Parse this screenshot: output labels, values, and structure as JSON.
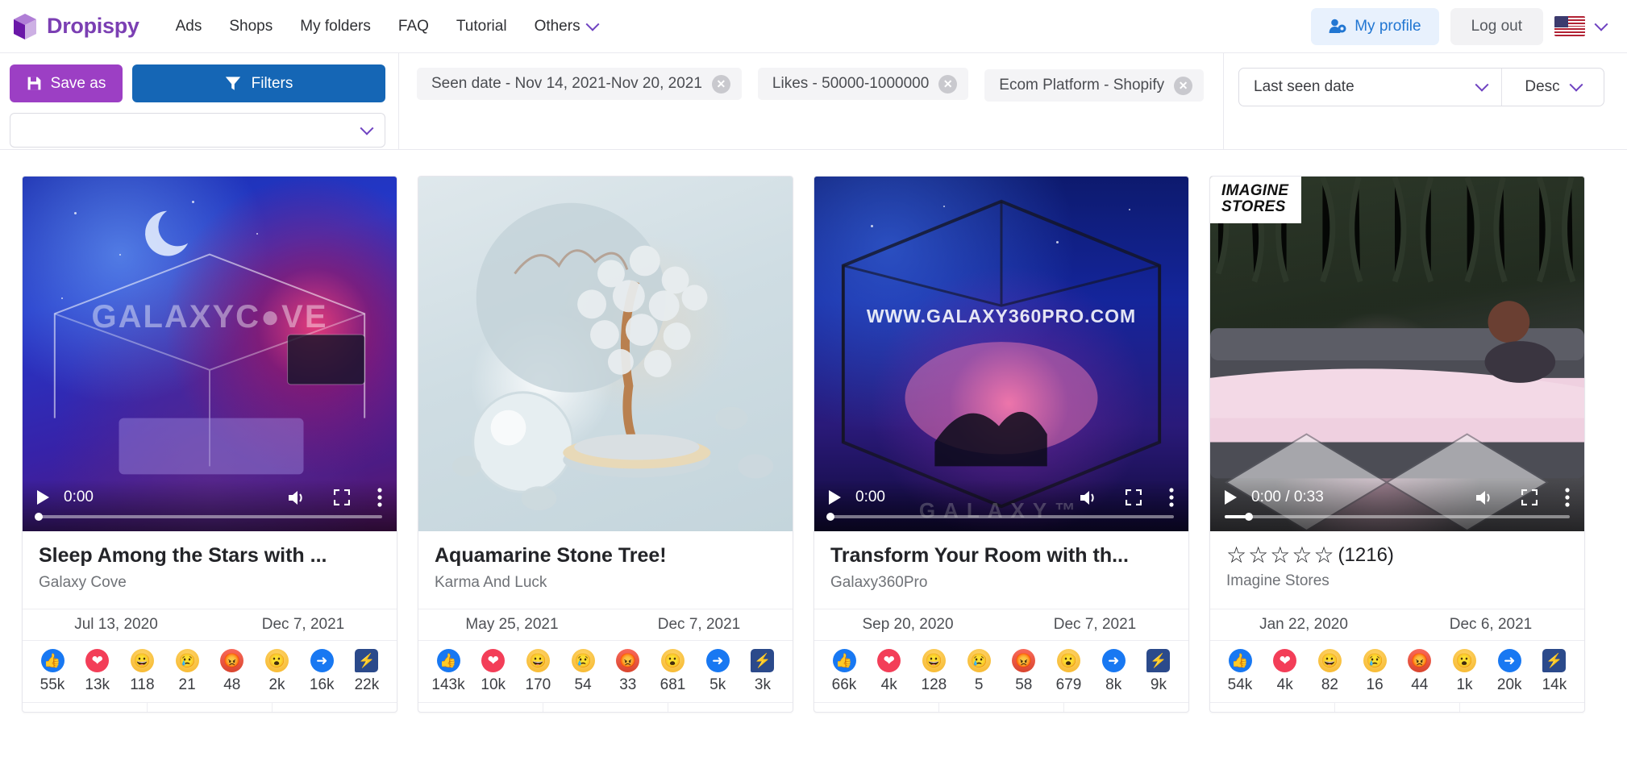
{
  "nav": {
    "brand": "Dropispy",
    "links": [
      "Ads",
      "Shops",
      "My folders",
      "FAQ",
      "Tutorial"
    ],
    "others_label": "Others",
    "profile_label": "My profile",
    "logout_label": "Log out",
    "flag": "us-flag"
  },
  "filterbar": {
    "save_as_label": "Save as",
    "filters_label": "Filters",
    "preset_value": "",
    "chips": [
      {
        "label": "Seen date - Nov 14, 2021-Nov 20, 2021"
      },
      {
        "label": "Likes - 50000-1000000"
      },
      {
        "label": "Ecom Platform - Shopify"
      }
    ],
    "sort_field": "Last seen date",
    "sort_direction": "Desc"
  },
  "cards": [
    {
      "title": "Sleep Among the Stars with ...",
      "shop": "Galaxy Cove",
      "watermark": "GALAXYC●VE",
      "first_seen": "Jul 13, 2020",
      "last_seen": "Dec 7, 2021",
      "video": {
        "time": "0:00",
        "progress": 0
      },
      "rating": null,
      "reactions": [
        {
          "type": "like",
          "value": "55k"
        },
        {
          "type": "love",
          "value": "13k"
        },
        {
          "type": "haha",
          "value": "118"
        },
        {
          "type": "sad",
          "value": "21"
        },
        {
          "type": "angry",
          "value": "48"
        },
        {
          "type": "wow",
          "value": "2k"
        },
        {
          "type": "share",
          "value": "16k"
        },
        {
          "type": "message",
          "value": "22k"
        }
      ]
    },
    {
      "title": "Aquamarine Stone Tree!",
      "shop": "Karma And Luck",
      "watermark": "",
      "first_seen": "May 25, 2021",
      "last_seen": "Dec 7, 2021",
      "video": null,
      "rating": null,
      "reactions": [
        {
          "type": "like",
          "value": "143k"
        },
        {
          "type": "love",
          "value": "10k"
        },
        {
          "type": "haha",
          "value": "170"
        },
        {
          "type": "sad",
          "value": "54"
        },
        {
          "type": "angry",
          "value": "33"
        },
        {
          "type": "wow",
          "value": "681"
        },
        {
          "type": "share",
          "value": "5k"
        },
        {
          "type": "message",
          "value": "3k"
        }
      ]
    },
    {
      "title": "Transform Your Room with th...",
      "shop": "Galaxy360Pro",
      "watermark": "WWW.GALAXY360PRO.COM",
      "watermark_bottom": "GALAXY™",
      "first_seen": "Sep 20, 2020",
      "last_seen": "Dec 7, 2021",
      "video": {
        "time": "0:00",
        "progress": 0
      },
      "rating": null,
      "reactions": [
        {
          "type": "like",
          "value": "66k"
        },
        {
          "type": "love",
          "value": "4k"
        },
        {
          "type": "haha",
          "value": "128"
        },
        {
          "type": "sad",
          "value": "5"
        },
        {
          "type": "angry",
          "value": "58"
        },
        {
          "type": "wow",
          "value": "679"
        },
        {
          "type": "share",
          "value": "8k"
        },
        {
          "type": "message",
          "value": "9k"
        }
      ]
    },
    {
      "title": "",
      "shop": "Imagine Stores",
      "logo_badge_line1": "IMAGINE",
      "logo_badge_line2": "STORES",
      "first_seen": "Jan 22, 2020",
      "last_seen": "Dec 6, 2021",
      "video": {
        "time": "0:00 / 0:33",
        "progress": 7
      },
      "rating": {
        "stars": 5,
        "filled": 0,
        "count": "(1216)"
      },
      "reactions": [
        {
          "type": "like",
          "value": "54k"
        },
        {
          "type": "love",
          "value": "4k"
        },
        {
          "type": "haha",
          "value": "82"
        },
        {
          "type": "sad",
          "value": "16"
        },
        {
          "type": "angry",
          "value": "44"
        },
        {
          "type": "wow",
          "value": "1k"
        },
        {
          "type": "share",
          "value": "20k"
        },
        {
          "type": "message",
          "value": "14k"
        }
      ]
    }
  ],
  "colors": {
    "brand_purple": "#7b3fb3",
    "save_purple": "#9c3fc4",
    "filter_blue": "#1566b5",
    "profile_blue": "#2176d2",
    "fb_like_blue": "#1878f2",
    "fb_love_red": "#f33e58"
  }
}
